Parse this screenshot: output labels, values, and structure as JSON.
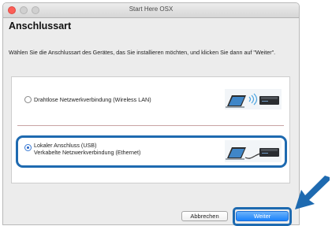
{
  "window": {
    "title": "Start Here OSX"
  },
  "page": {
    "heading": "Anschlussart",
    "instruction": "Wählen Sie die Anschlussart des Gerätes, das Sie installieren möchten, und klicken Sie dann auf \"Weiter\"."
  },
  "options": [
    {
      "label_line1": "Drahtlose Netzwerkverbindung (Wireless LAN)",
      "label_line2": "",
      "selected": false
    },
    {
      "label_line1": "Lokaler Anschluss (USB)",
      "label_line2": "Verkabelte Netzwerkverbindung (Ethernet)",
      "selected": true
    }
  ],
  "buttons": {
    "cancel": "Abbrechen",
    "next": "Weiter"
  },
  "colors": {
    "accent": "#1e6ab0",
    "primary_button": "#1a82fb",
    "close_light": "#fc5f57"
  },
  "icons": [
    "close-icon",
    "minimize-icon",
    "zoom-icon",
    "laptop-wireless-printer-icon",
    "laptop-cable-printer-icon",
    "callout-arrow-icon"
  ]
}
